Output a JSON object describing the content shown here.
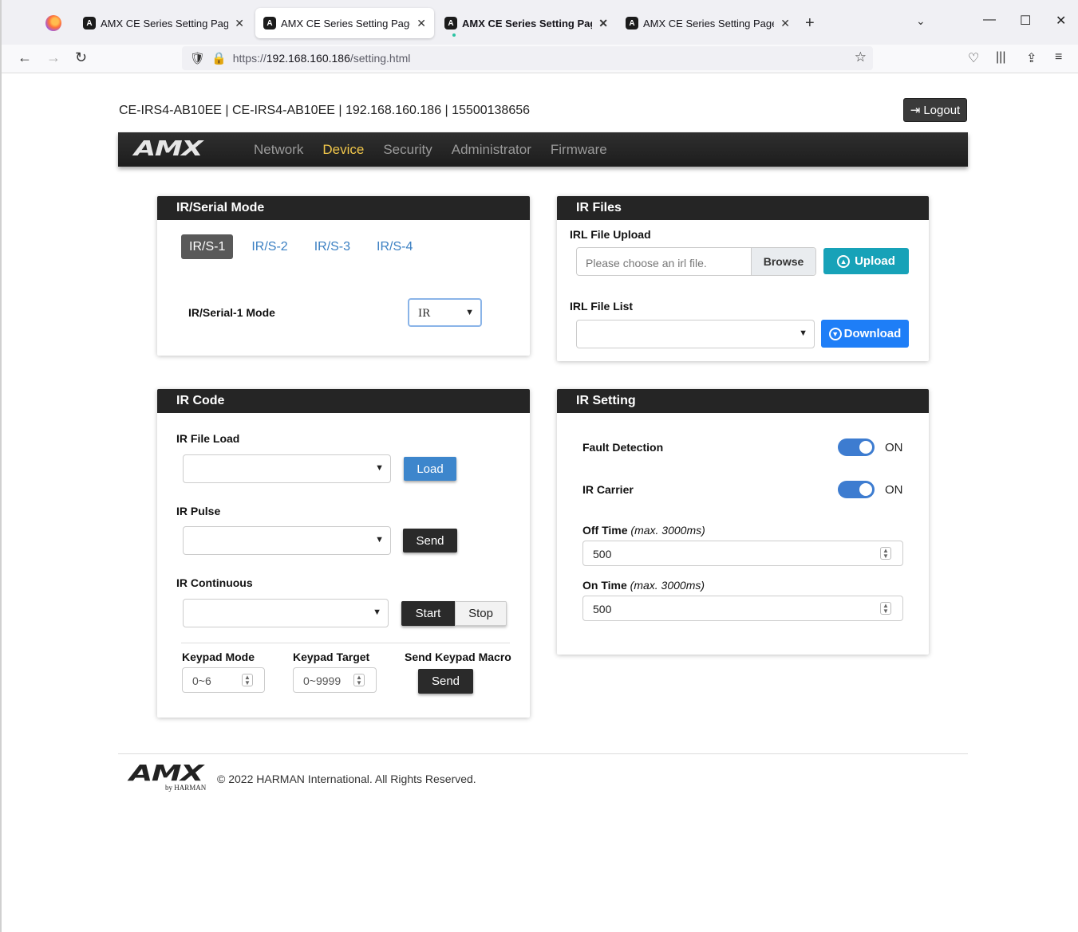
{
  "browser": {
    "tabs": [
      {
        "title": "AMX CE Series Setting Page",
        "favicon": "amx-favicon"
      },
      {
        "title": "AMX CE Series Setting Page",
        "favicon": "amx-favicon"
      },
      {
        "title": "AMX CE Series Setting Page",
        "favicon": "amx-favicon"
      },
      {
        "title": "AMX CE Series Setting Page",
        "favicon": "amx-favicon"
      }
    ],
    "active_tab": 1,
    "url_prefix": "https://",
    "url_host": "192.168.160.186",
    "url_path": "/setting.html"
  },
  "header": {
    "device_info": "CE-IRS4-AB10EE  |  CE-IRS4-AB10EE  |  192.168.160.186  |  15500138656",
    "logout_label": "Logout"
  },
  "nav": {
    "logo_text": "AMX",
    "items": [
      "Network",
      "Device",
      "Security",
      "Administrator",
      "Firmware"
    ],
    "active_item": "Device",
    "active_color": "#f0c64a"
  },
  "ir_serial_mode": {
    "title": "IR/Serial Mode",
    "tabs": [
      "IR/S-1",
      "IR/S-2",
      "IR/S-3",
      "IR/S-4"
    ],
    "active_tab": "IR/S-1",
    "mode_label": "IR/Serial-1 Mode",
    "mode_value": "IR"
  },
  "ir_files": {
    "title": "IR Files",
    "upload_label": "IRL File Upload",
    "upload_placeholder": "Please choose an irl file.",
    "browse_label": "Browse",
    "upload_button": "Upload",
    "list_label": "IRL File List",
    "download_button": "Download"
  },
  "ir_code": {
    "title": "IR Code",
    "file_load_label": "IR File Load",
    "load_button": "Load",
    "pulse_label": "IR Pulse",
    "send_button": "Send",
    "continuous_label": "IR Continuous",
    "start_button": "Start",
    "stop_button": "Stop",
    "keypad_mode_label": "Keypad Mode",
    "keypad_mode_placeholder": "0~6",
    "keypad_target_label": "Keypad Target",
    "keypad_target_placeholder": "0~9999",
    "keypad_macro_label": "Send Keypad Macro",
    "keypad_send_button": "Send"
  },
  "ir_setting": {
    "title": "IR Setting",
    "fault_detection_label": "Fault Detection",
    "fault_detection_state": "ON",
    "ir_carrier_label": "IR Carrier",
    "ir_carrier_state": "ON",
    "off_time_label": "Off Time",
    "off_time_hint": "(max. 3000ms)",
    "off_time_value": "500",
    "on_time_label": "On Time",
    "on_time_hint": "(max. 3000ms)",
    "on_time_value": "500"
  },
  "footer": {
    "logo_text": "AMX",
    "logo_sub": "by HARMAN",
    "copyright": "© 2022 HARMAN International. All Rights Reserved."
  }
}
